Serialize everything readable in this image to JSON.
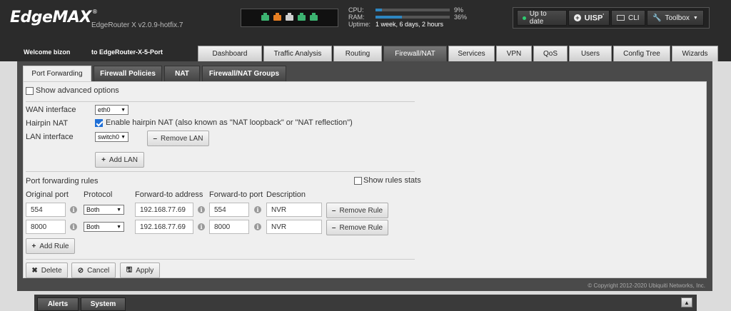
{
  "header": {
    "logo": "EdgeMAX",
    "logo_mark": "®",
    "version": "EdgeRouter X v2.0.9-hotfix.7",
    "ports": [
      "#3cb371",
      "#e67e22",
      "#cfcfcf",
      "#3cb371",
      "#3cb371"
    ],
    "stats": {
      "cpu_label": "CPU:",
      "cpu_value": "9%",
      "cpu_fraction": 0.09,
      "ram_label": "RAM:",
      "ram_value": "36%",
      "ram_fraction": 0.36,
      "uptime_label": "Uptime:",
      "uptime_value": "1 week, 6 days, 2 hours"
    },
    "tools": {
      "uptodate": "Up to date",
      "uisp": "UISP",
      "uisp_mark": "'",
      "cli": "CLI",
      "toolbox": "Toolbox"
    }
  },
  "user": {
    "welcome": "Welcome bizon",
    "router": "to EdgeRouter-X-5-Port"
  },
  "main_tabs": [
    "Dashboard",
    "Traffic Analysis",
    "Routing",
    "Firewall/NAT",
    "Services",
    "VPN",
    "QoS",
    "Users",
    "Config Tree",
    "Wizards"
  ],
  "sub_tabs": [
    "Port Forwarding",
    "Firewall Policies",
    "NAT",
    "Firewall/NAT Groups"
  ],
  "form": {
    "show_advanced": "Show advanced options",
    "wan_label": "WAN interface",
    "wan_value": "eth0",
    "hairpin_label": "Hairpin NAT",
    "hairpin_text": "Enable hairpin NAT (also known as \"NAT loopback\" or \"NAT reflection\")",
    "lan_label": "LAN interface",
    "lan_value": "switch0",
    "remove_lan": "Remove LAN",
    "add_lan": "Add LAN",
    "rules_title": "Port forwarding rules",
    "show_stats": "Show rules stats",
    "columns": [
      "Original port",
      "Protocol",
      "Forward-to address",
      "Forward-to port",
      "Description"
    ],
    "rules": [
      {
        "orig": "554",
        "protocol": "Both",
        "address": "192.168.77.69",
        "fwd_port": "554",
        "desc": "NVR"
      },
      {
        "orig": "8000",
        "protocol": "Both",
        "address": "192.168.77.69",
        "fwd_port": "8000",
        "desc": "NVR"
      }
    ],
    "remove_rule": "Remove Rule",
    "add_rule": "Add Rule",
    "delete": "Delete",
    "cancel": "Cancel",
    "apply": "Apply"
  },
  "copyright": "© Copyright 2012-2020 Ubiquiti Networks, Inc.",
  "bottom_tabs": [
    "Alerts",
    "System"
  ],
  "colors": {
    "accent": "#2e86c1",
    "checkbox": "#1f6fd6"
  }
}
